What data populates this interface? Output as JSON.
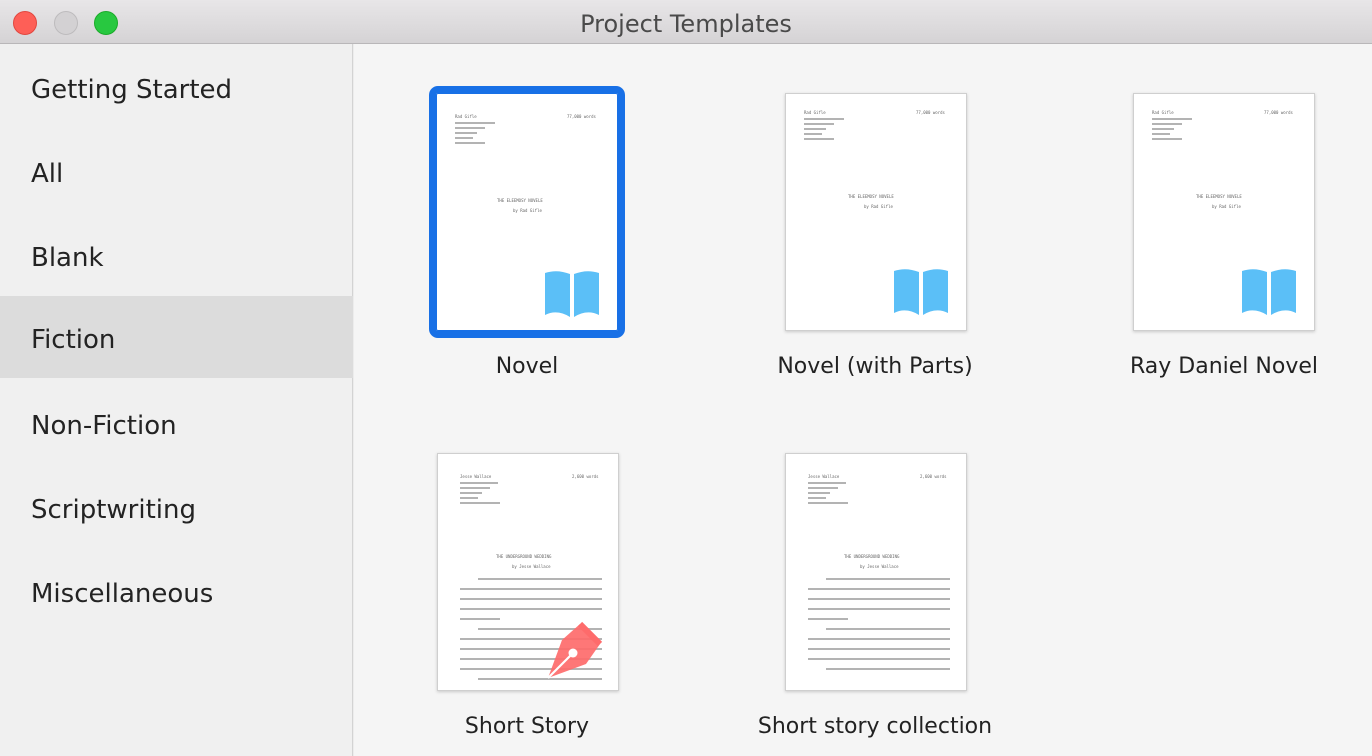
{
  "window": {
    "title": "Project Templates"
  },
  "sidebar": {
    "items": [
      {
        "label": "Getting Started"
      },
      {
        "label": "All"
      },
      {
        "label": "Blank"
      },
      {
        "label": "Fiction"
      },
      {
        "label": "Non-Fiction"
      },
      {
        "label": "Scriptwriting"
      },
      {
        "label": "Miscellaneous"
      }
    ],
    "selected": "Fiction"
  },
  "templates": [
    {
      "label": "Novel",
      "icon": "book-icon",
      "selected": true,
      "page": {
        "author": "Rad Gifle",
        "words": "77,000 words",
        "title": "THE ELEEMOSY NOVELE",
        "byline": "by Rad Gifle"
      }
    },
    {
      "label": "Novel (with Parts)",
      "icon": "book-icon",
      "selected": false,
      "page": {
        "author": "Rad Gifle",
        "words": "77,000 words",
        "title": "THE ELEEMOSY NOVELE",
        "byline": "by Rad Gifle"
      }
    },
    {
      "label": "Ray Daniel Novel",
      "icon": "book-icon",
      "selected": false,
      "page": {
        "author": "Rad Gifle",
        "words": "77,000 words",
        "title": "THE ELEEMOSY NOVELE",
        "byline": "by Rad Gifle"
      }
    },
    {
      "label": "Short Story",
      "icon": "fountain-pen-icon",
      "selected": false,
      "page": {
        "author": "Jesse Wallace",
        "words": "2,600 words",
        "title": "THE UNDERGROUND WEDDING",
        "byline": "by Jesse Wallace"
      }
    },
    {
      "label": "Short story collection",
      "icon": "none",
      "selected": false,
      "page": {
        "author": "Jesse Wallace",
        "words": "2,600 words",
        "title": "THE UNDERGROUND WEDDING",
        "byline": "by Jesse Wallace"
      }
    }
  ],
  "colors": {
    "selection": "#1870e6",
    "book_icon": "#5bbff7",
    "pen_icon": "#fe6b6b"
  }
}
